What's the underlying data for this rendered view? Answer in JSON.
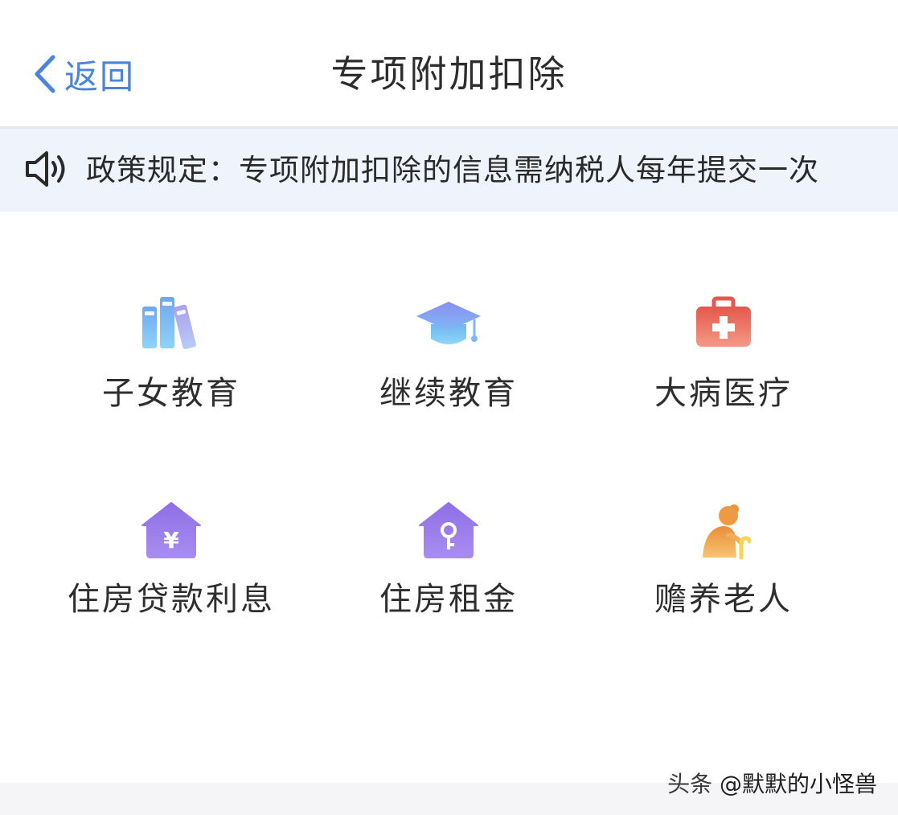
{
  "header": {
    "back_label": "返回",
    "title": "专项附加扣除"
  },
  "notice": {
    "text": "政策规定：专项附加扣除的信息需纳税人每年提交一次"
  },
  "items": [
    {
      "label": "子女教育",
      "icon": "books-icon"
    },
    {
      "label": "继续教育",
      "icon": "graduation-cap-icon"
    },
    {
      "label": "大病医疗",
      "icon": "medical-kit-icon"
    },
    {
      "label": "住房贷款利息",
      "icon": "house-yen-icon"
    },
    {
      "label": "住房租金",
      "icon": "house-key-icon"
    },
    {
      "label": "赡养老人",
      "icon": "elderly-person-icon"
    }
  ],
  "watermark": {
    "prefix": "头条",
    "handle": "@默默的小怪兽"
  },
  "colors": {
    "accent_blue": "#4a84dc",
    "notice_bg": "#eef3fc",
    "purple": "#9b7fe9",
    "red": "#e86d5e",
    "orange": "#f0a84c"
  }
}
